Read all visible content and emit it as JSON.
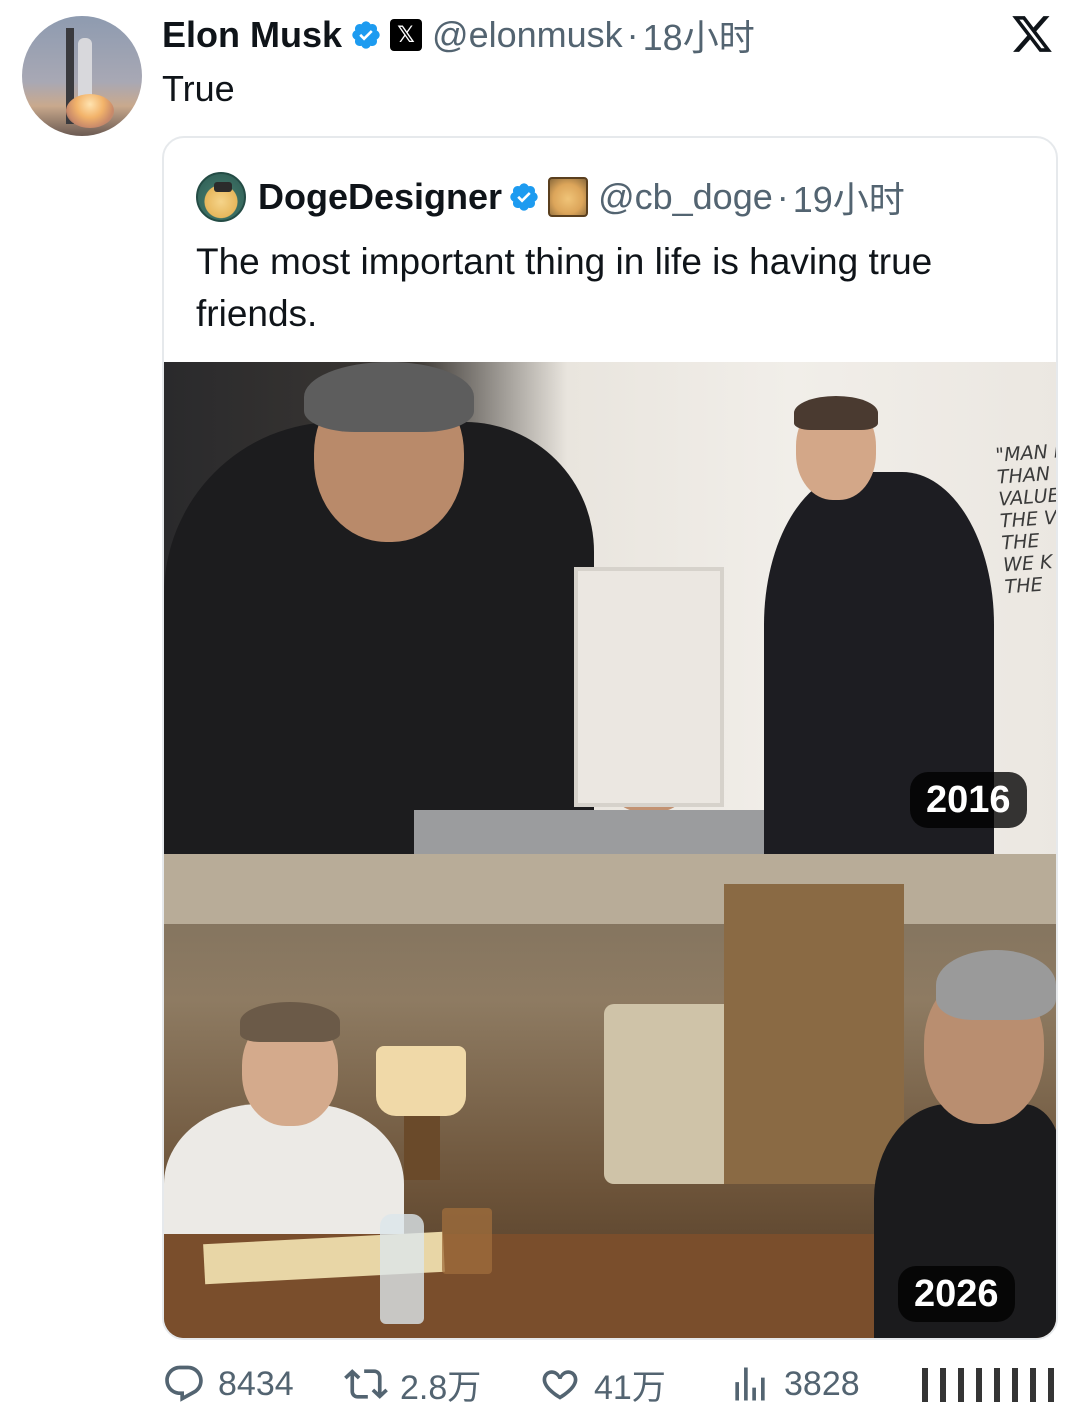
{
  "tweet": {
    "author_name": "Elon Musk",
    "author_handle": "@elonmusk",
    "time": "18小时",
    "separator": "·",
    "text": "True",
    "badge_glyph": "𝕏"
  },
  "quote": {
    "author_name": "DogeDesigner",
    "author_handle": "@cb_doge",
    "time": "19小时",
    "separator": "·",
    "text": "The most important thing in life is having true friends."
  },
  "media": {
    "top_year": "2016",
    "bottom_year": "2026",
    "wall_text": "\"MAN H\nTHAN\nVALUE\nTHE V\nTHE\nWE K\nTHE"
  },
  "actions": {
    "replies": "8434",
    "retweets": "2.8万",
    "likes": "41万",
    "views": "3828"
  },
  "icons": {
    "verified": "verified-badge-icon",
    "close": "x-logo-icon",
    "reply": "reply-icon",
    "retweet": "retweet-icon",
    "like": "heart-icon",
    "views": "views-chart-icon"
  },
  "colors": {
    "verified_blue": "#1d9bf0",
    "secondary_text": "#536471",
    "primary_text": "#0f1419"
  }
}
